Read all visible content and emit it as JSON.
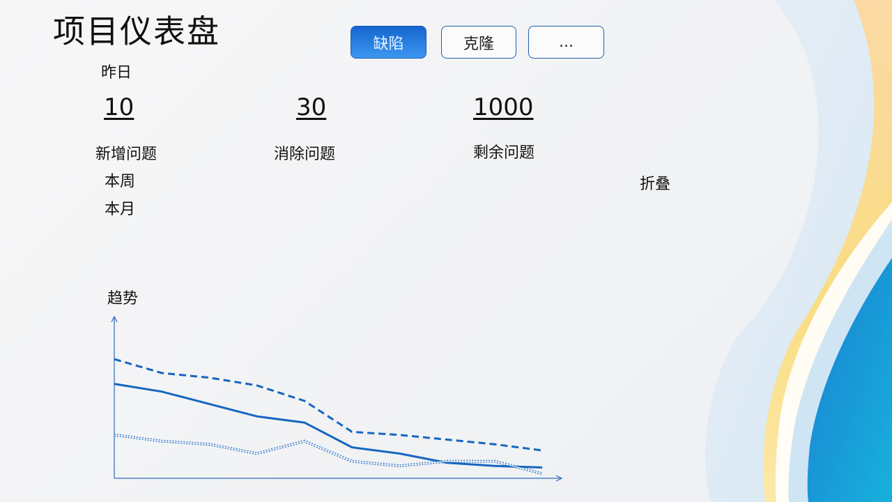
{
  "title": "项目仪表盘",
  "tabs": [
    {
      "label": "缺陷",
      "active": true
    },
    {
      "label": "克隆",
      "active": false
    },
    {
      "label": "...",
      "active": false
    }
  ],
  "period_options": [
    "昨日",
    "本周",
    "本月"
  ],
  "collapse_label": "折叠",
  "metrics": [
    {
      "value": "10",
      "label": "新增问题"
    },
    {
      "value": "30",
      "label": "消除问题"
    },
    {
      "value": "1000",
      "label": "剩余问题"
    }
  ],
  "trend_label": "趋势",
  "colors": {
    "accent": "#1565d0",
    "line": "#1565c0",
    "axis": "#2a6bbf"
  },
  "chart_data": {
    "type": "line",
    "x": [
      0,
      1,
      2,
      3,
      4,
      5,
      6,
      7,
      8,
      9
    ],
    "ylim": [
      0,
      100
    ],
    "series": [
      {
        "style": "dashed",
        "values": [
          77,
          68,
          65,
          60,
          50,
          30,
          28,
          25,
          22,
          18
        ]
      },
      {
        "style": "solid",
        "values": [
          61,
          56,
          48,
          40,
          36,
          20,
          16,
          10,
          8,
          7
        ]
      },
      {
        "style": "double-dotted",
        "values": [
          28,
          24,
          22,
          16,
          24,
          11,
          8,
          11,
          11,
          3
        ]
      }
    ]
  }
}
